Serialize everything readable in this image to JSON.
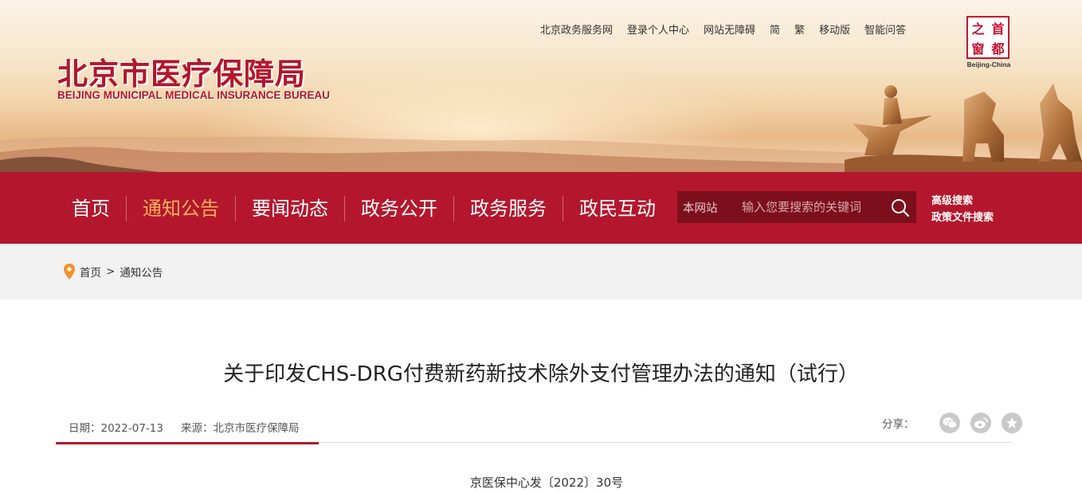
{
  "header": {
    "title_cn": "北京市医疗保障局",
    "title_en": "BEIJING MUNICIPAL MEDICAL INSURANCE BUREAU",
    "top_links": [
      "北京政务服务网",
      "登录个人中心",
      "网站无障碍",
      "简",
      "繁",
      "移动版",
      "智能问答"
    ],
    "seal": {
      "chars": [
        "之",
        "首",
        "窗",
        "都"
      ],
      "caption": "Beijing-China"
    }
  },
  "nav": {
    "items": [
      "首页",
      "通知公告",
      "要闻动态",
      "政务公开",
      "政务服务",
      "政民互动"
    ],
    "active": "通知公告",
    "search_scope": "本网站",
    "search_placeholder": "输入您要搜索的关键词",
    "advanced_search": "高级搜索",
    "policy_search": "政策文件搜索"
  },
  "breadcrumb": [
    "首页",
    "通知公告"
  ],
  "article": {
    "title": "关于印发CHS-DRG付费新药新技术除外支付管理办法的通知（试行）",
    "date_label": "日期：",
    "date": "2022-07-13",
    "source_label": "来源：",
    "source": "北京市医疗保障局",
    "share_label": "分享：",
    "share_icons": [
      "wechat-icon",
      "weibo-icon",
      "favorite-star-icon"
    ],
    "doc_number": "京医保中心发〔2022〕30号"
  },
  "colors": {
    "brand_red": "#b4172d",
    "active_nav": "#f7b15b"
  }
}
